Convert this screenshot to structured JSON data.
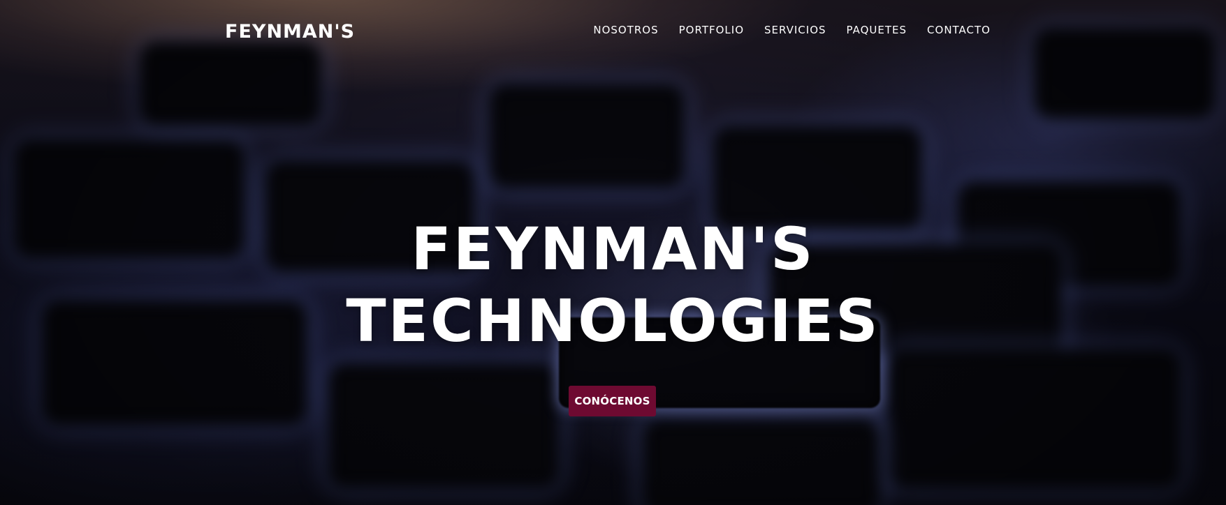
{
  "brand": {
    "logo_text": "FEYNMAN'S"
  },
  "nav": {
    "items": [
      {
        "label": "NOSOTROS"
      },
      {
        "label": "PORTFOLIO"
      },
      {
        "label": "SERVICIOS"
      },
      {
        "label": "PAQUETES"
      },
      {
        "label": "CONTACTO"
      }
    ]
  },
  "hero": {
    "title_line1": "FEYNMAN'S",
    "title_line2": "TECHNOLOGIES",
    "cta_label": "CONÓCENOS",
    "background": "blurred backlit keyboard"
  },
  "colors": {
    "cta_background": "#6e0a31",
    "text": "#ffffff",
    "key_backlight": "#7f8cf0"
  }
}
